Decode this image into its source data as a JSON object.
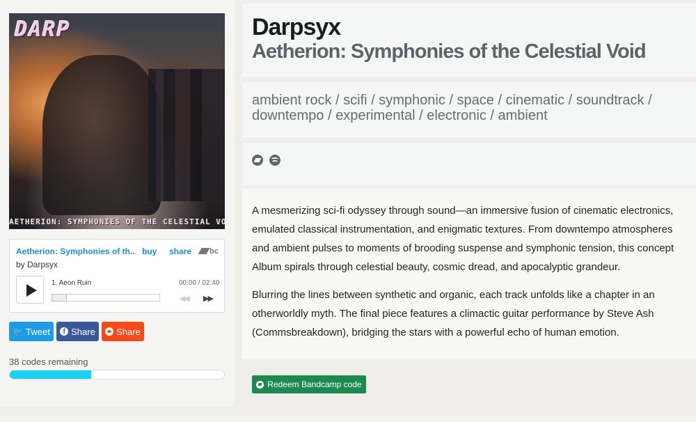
{
  "cover": {
    "logo_text": "DARP",
    "caption": "AETHERION: SYMPHONIES OF THE CELESTIAL VOID"
  },
  "player": {
    "album_title": "Aetherion: Symphonies of th...",
    "buy_label": "buy",
    "share_label": "share",
    "brand": "bc",
    "by_line": "by Darpsyx",
    "track": "1.  Aeon Ruin",
    "time": "00:00 / 02:40"
  },
  "share_buttons": {
    "twitter": "Tweet",
    "facebook": "Share",
    "reddit": "Share"
  },
  "codes": {
    "remaining_text": "38 codes remaining",
    "progress_fraction": 0.38
  },
  "header": {
    "artist": "Darpsyx",
    "album": "Aetherion: Symphonies of the Celestial Void"
  },
  "tags_text": "ambient rock / scifi / symphonic / space / cinematic / soundtrack / downtempo / experimental / electronic / ambient",
  "description": {
    "p1": "A mesmerizing sci-fi odyssey through sound—an immersive fusion of cinematic electronics, emulated classical instrumentation, and enigmatic textures. From downtempo atmospheres and ambient pulses to moments of brooding suspense and symphonic tension, this concept Album spirals through celestial beauty, cosmic dread, and apocalyptic grandeur.",
    "p2": "Blurring the lines between synthetic and organic, each track unfolds like a chapter in an otherworldly myth. The final piece features a climactic guitar performance by Steve Ash (Commsbreakdown), bridging the stars with a powerful echo of human emotion."
  },
  "redeem_label": "Redeem Bandcamp code",
  "icons": {
    "link_1": "bandcamp-icon",
    "link_2": "spotify-icon"
  },
  "colors": {
    "link_blue": "#1e8ccc",
    "twitter": "#1e9ce6",
    "facebook": "#3b5998",
    "reddit": "#f54a1a",
    "progress": "#17d4f5",
    "redeem": "#1a8a4f"
  }
}
